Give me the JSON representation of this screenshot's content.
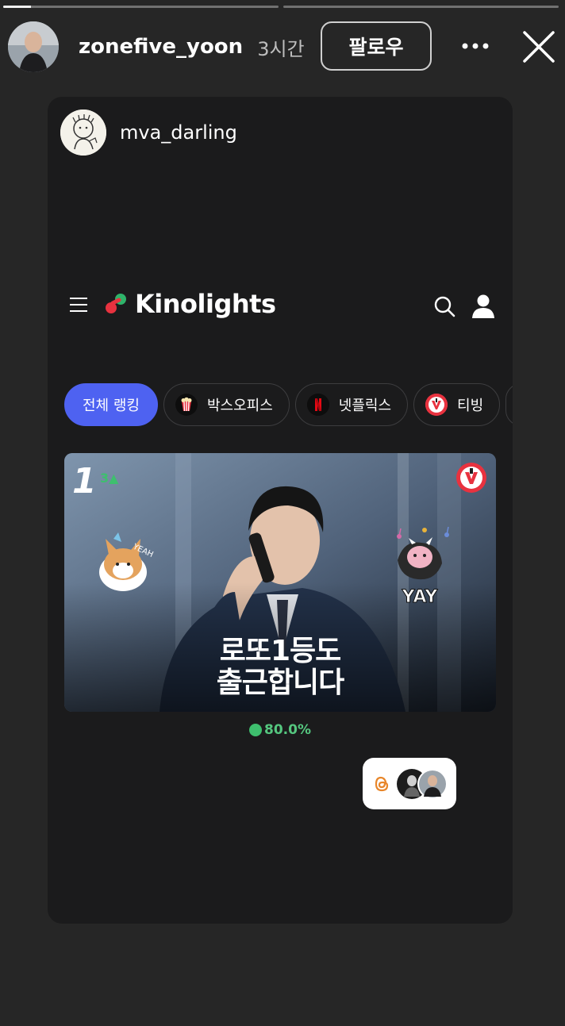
{
  "story": {
    "progress": [
      0.1,
      0.0
    ],
    "username": "zonefive_yoon",
    "time": "3시간",
    "follow_label": "팔로우"
  },
  "card": {
    "username": "mva_darling",
    "app": {
      "logo_text": "Kinolights"
    },
    "chips": [
      {
        "label": "전체 랭킹",
        "icon": ""
      },
      {
        "label": "박스오피스",
        "icon": "popcorn-icon"
      },
      {
        "label": "넷플릭스",
        "icon": "netflix-icon"
      },
      {
        "label": "티빙",
        "icon": "tving-icon"
      }
    ],
    "ranking": {
      "rank": "1",
      "change": "3▲",
      "title_line1": "로또1등도",
      "title_line2": "출근합니다",
      "sticker_left": "YEAH",
      "sticker_right": "YAY",
      "score": "80.0%"
    }
  },
  "colors": {
    "accent_blue": "#4e62f1",
    "score_green": "#3ebf6e",
    "tving_red": "#e8323f",
    "netflix_red": "#e50914"
  }
}
